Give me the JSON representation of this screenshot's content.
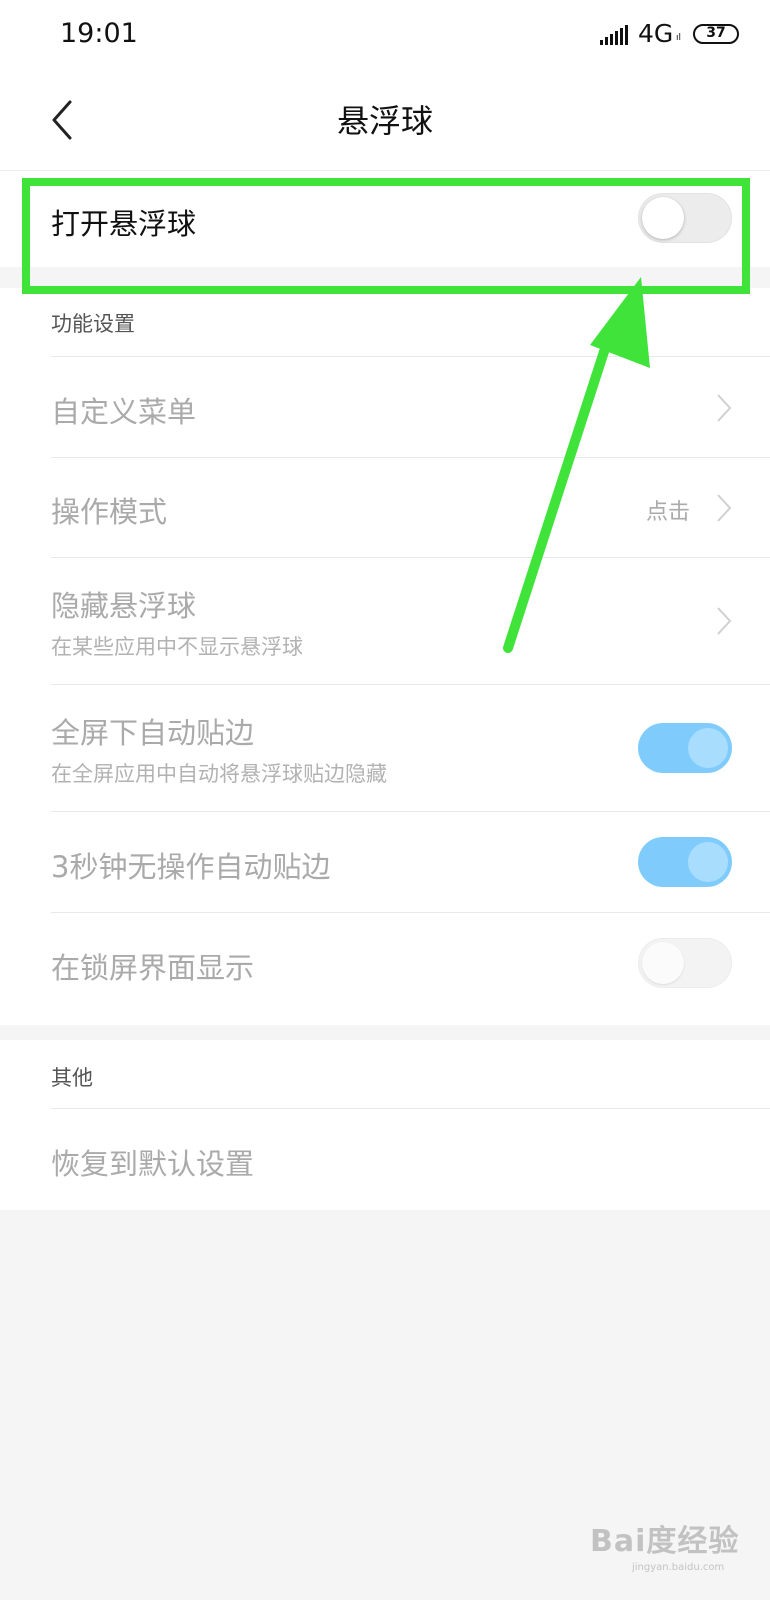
{
  "status_bar": {
    "time": "19:01",
    "network": "4G",
    "network_sub": "ıl",
    "battery": "37"
  },
  "header": {
    "title": "悬浮球",
    "back_icon": "chevron-left-icon"
  },
  "main_toggle": {
    "label": "打开悬浮球",
    "enabled": false
  },
  "feature_section": {
    "title": "功能设置",
    "items": [
      {
        "label": "自定义菜单",
        "control": "chevron"
      },
      {
        "label": "操作模式",
        "value": "点击",
        "control": "chevron"
      },
      {
        "label": "隐藏悬浮球",
        "sublabel": "在某些应用中不显示悬浮球",
        "control": "chevron"
      },
      {
        "label": "全屏下自动贴边",
        "sublabel": "在全屏应用中自动将悬浮球贴边隐藏",
        "control": "toggle",
        "enabled": true
      },
      {
        "label": "3秒钟无操作自动贴边",
        "control": "toggle",
        "enabled": true
      },
      {
        "label": "在锁屏界面显示",
        "control": "toggle",
        "enabled": false
      }
    ]
  },
  "other_section": {
    "title": "其他",
    "items": [
      {
        "label": "恢复到默认设置"
      }
    ]
  },
  "annotation": {
    "highlight_color": "#3fe33a",
    "arrow_color": "#3fe33a"
  },
  "colors": {
    "toggle_on": "#7fccfc",
    "toggle_off": "#ececec"
  },
  "watermark": {
    "main": "Bai度经验",
    "sub": "jingyan.baidu.com"
  }
}
